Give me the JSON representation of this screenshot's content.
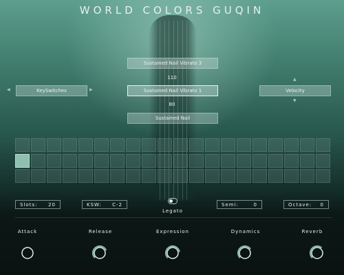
{
  "title": "WORLD COLORS GUQIN",
  "articulations": {
    "upper": "Sustained Nail Vibrato 3",
    "upper_value": "110",
    "selected": "Sustained Nail Vibrato 1",
    "lower_value": "80",
    "lower": "Sustained Nail"
  },
  "left_selector": {
    "label": "KeySwitches"
  },
  "right_selector": {
    "label": "Velocity"
  },
  "pad_grid": {
    "rows": 3,
    "columns": 20,
    "active_pad": {
      "row": 2,
      "column": 1
    }
  },
  "params": {
    "slots": {
      "label": "Slots:",
      "value": "20"
    },
    "ksw": {
      "label": "KSW:",
      "value": "C-2"
    },
    "legato": {
      "label": "Legato",
      "on": true
    },
    "semi": {
      "label": "Semi:",
      "value": "0"
    },
    "octave": {
      "label": "Octave:",
      "value": "0"
    }
  },
  "knobs": [
    {
      "label": "Attack",
      "level": 0.0
    },
    {
      "label": "Release",
      "level": 0.75
    },
    {
      "label": "Expression",
      "level": 0.8
    },
    {
      "label": "Dynamics",
      "level": 0.7
    },
    {
      "label": "Reverb",
      "level": 0.65
    }
  ],
  "colors": {
    "accent": "#8fbfb1",
    "text": "#e8f2ef"
  }
}
